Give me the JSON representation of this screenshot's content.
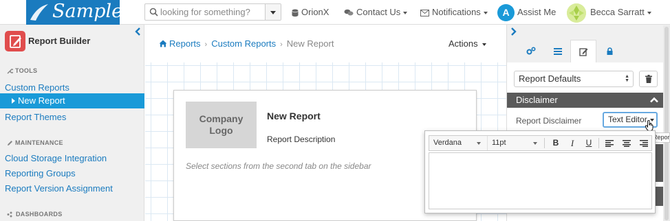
{
  "brand": {
    "logo_text": "Sample",
    "accent": "#1a7bbf",
    "active_color": "#1a9ad8"
  },
  "topbar": {
    "search": {
      "placeholder": "looking for something?",
      "value": ""
    },
    "orionx_label": "OrionX",
    "contact_label": "Contact Us",
    "notifications_label": "Notifications",
    "assist_badge": "A",
    "assist_label": "Assist Me",
    "user_name": "Becca Sarratt"
  },
  "sidebar": {
    "title": "Report Builder",
    "sections": [
      {
        "title": "TOOLS",
        "items": [
          "Custom Reports",
          "New Report",
          "Report Themes"
        ]
      },
      {
        "title": "MAINTENANCE",
        "items": [
          "Cloud Storage Integration",
          "Reporting Groups",
          "Report Version Assignment"
        ]
      },
      {
        "title": "DASHBOARDS",
        "items": []
      }
    ],
    "active_item": "New Report"
  },
  "breadcrumb": {
    "items": [
      "Reports",
      "Custom Reports"
    ],
    "current": "New Report"
  },
  "actions_label": "Actions",
  "report": {
    "logo_line1": "Company",
    "logo_line2": "Logo",
    "title": "New Report",
    "description": "Report Description",
    "hint": "Select sections from the second tab on the sidebar"
  },
  "right_panel": {
    "tabs": [
      "settings-icon",
      "list-icon",
      "edit-icon",
      "lock-icon"
    ],
    "active_tab": 2,
    "select_value": "Report Defaults",
    "section_title": "Disclaimer",
    "disclaimer_label": "Report Disclaimer",
    "editor_button": "Text Editor",
    "tooltip": "Report"
  },
  "editor": {
    "font": "Verdana",
    "size": "11pt",
    "bold": "B",
    "italic": "I",
    "underline": "U",
    "content": ""
  }
}
